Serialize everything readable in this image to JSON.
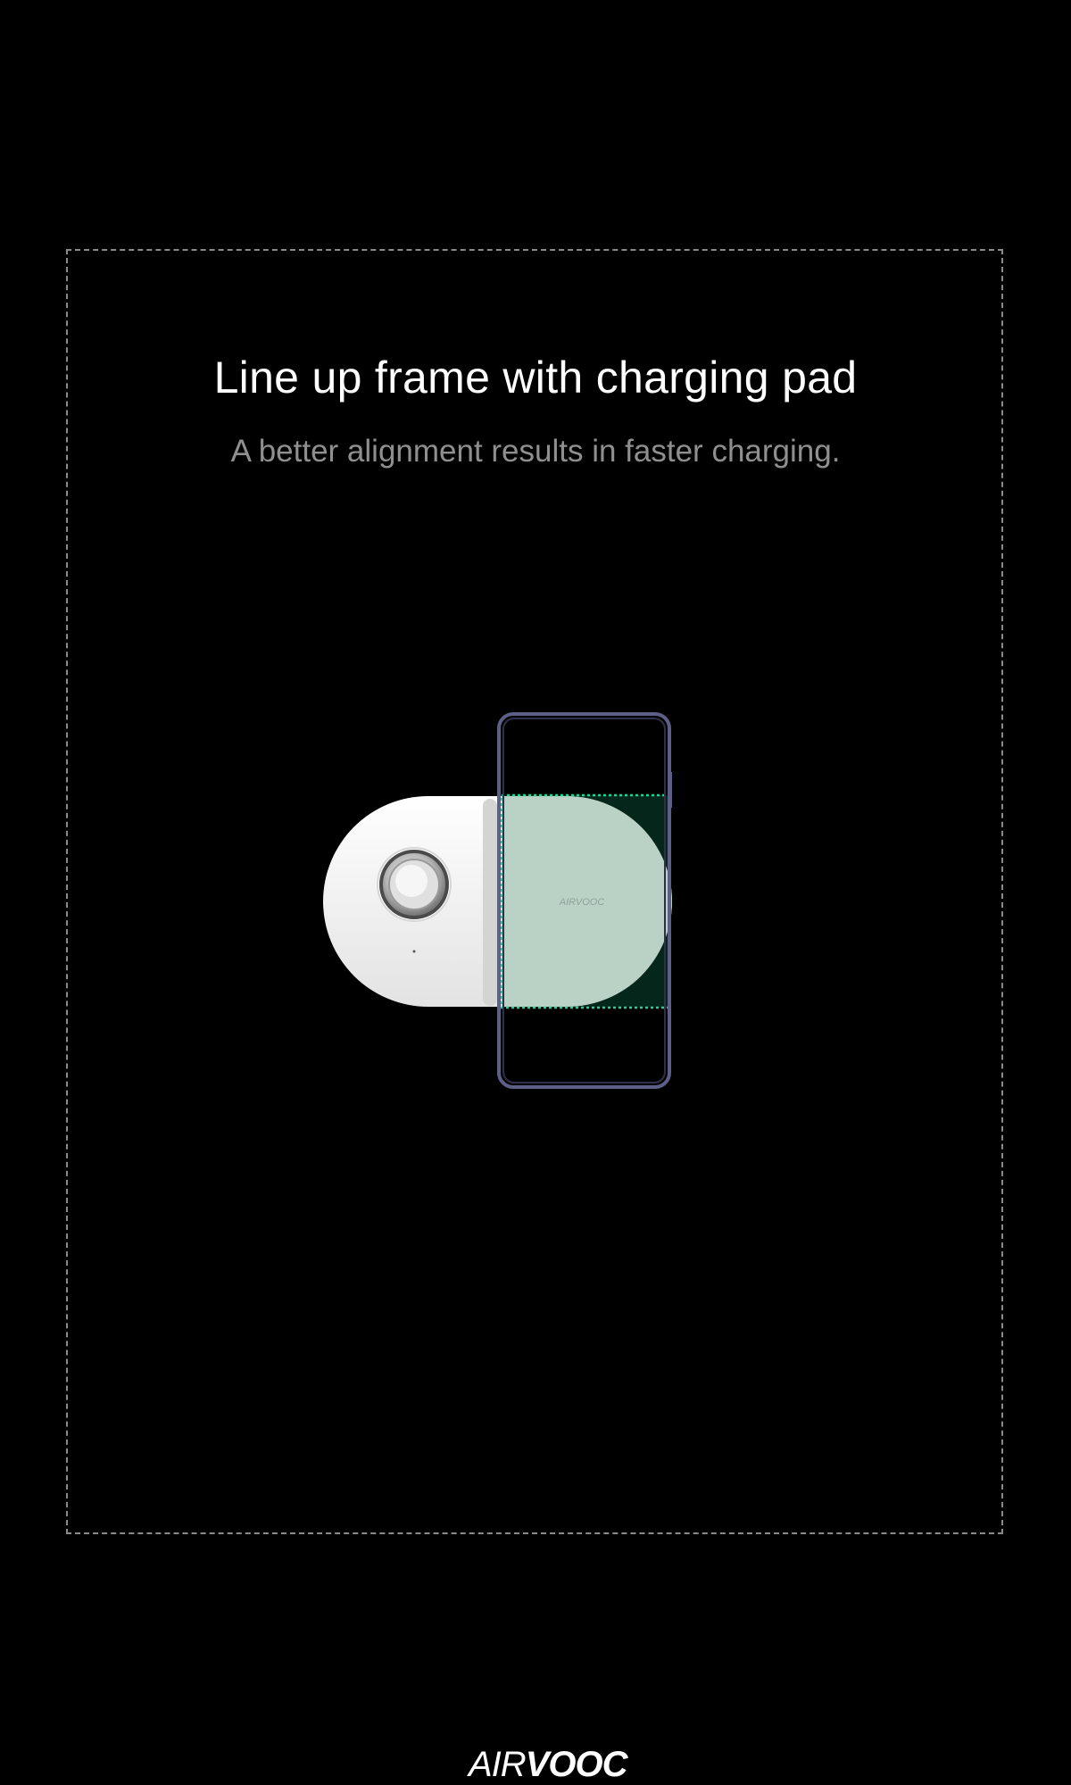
{
  "alignment_screen": {
    "title": "Line up frame with charging pad",
    "subtitle": "A better alignment results in faster charging."
  },
  "illustration": {
    "pad_logo_text": "AIRVOOC",
    "pad_color": "#f4f4f4",
    "highlight_color": "#1fd39a",
    "phone_frame_color": "#5d5f86"
  },
  "footer": {
    "brand_air": "AIR",
    "brand_vooc": "VOOC"
  }
}
